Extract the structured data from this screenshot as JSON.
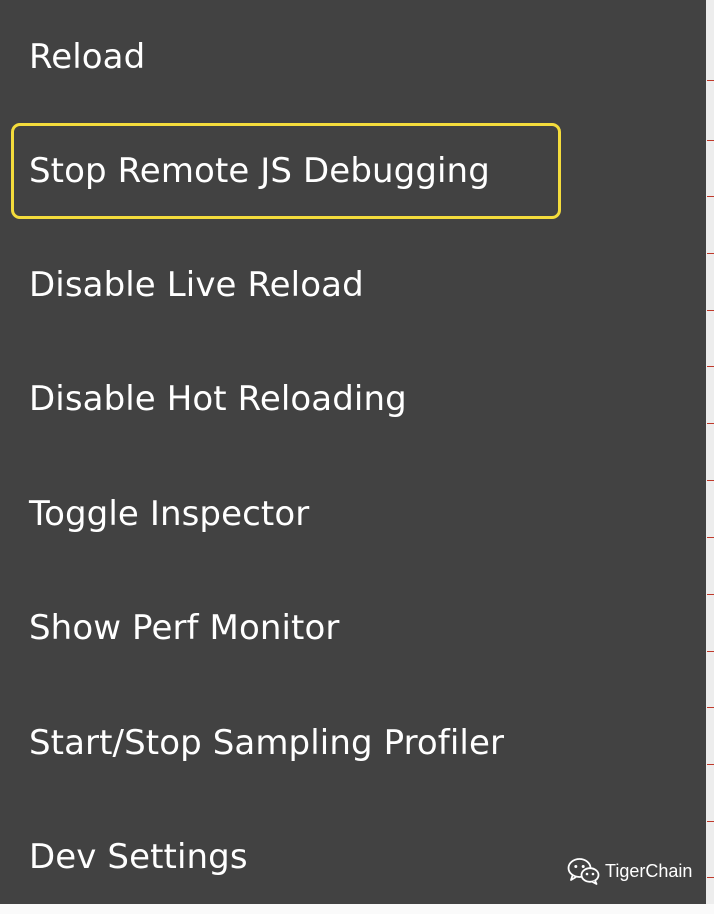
{
  "menu": {
    "items": [
      {
        "label": "Reload"
      },
      {
        "label": "Stop Remote JS Debugging"
      },
      {
        "label": "Disable Live Reload"
      },
      {
        "label": "Disable Hot Reloading"
      },
      {
        "label": "Toggle Inspector"
      },
      {
        "label": "Show Perf Monitor"
      },
      {
        "label": "Start/Stop Sampling Profiler"
      },
      {
        "label": "Dev Settings"
      }
    ],
    "highlighted_item": "Stop Remote JS Debugging"
  },
  "watermark": {
    "icon": "wechat-icon",
    "text": "TigerChain"
  },
  "colors": {
    "menu_background": "#424242",
    "text": "#ffffff",
    "highlight_border": "#f4dc3c"
  }
}
